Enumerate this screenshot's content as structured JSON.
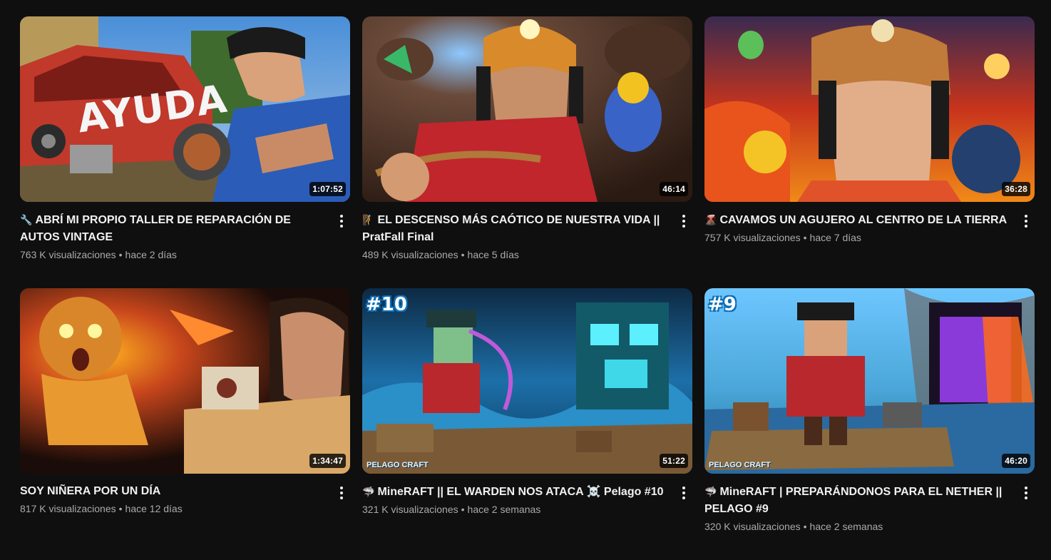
{
  "colors": {
    "background": "#0f0f0f",
    "text_primary": "#f1f1f1",
    "text_secondary": "#aaaaaa"
  },
  "videos": [
    {
      "emoji": "🔧",
      "title": "ABRÍ MI PROPIO TALLER DE REPARACIÓN DE AUTOS VINTAGE",
      "views": "763 K visualizaciones",
      "age": "hace 2 días",
      "duration": "1:07:52",
      "thumb_text": "AYUDA"
    },
    {
      "emoji": "🧗",
      "title": "EL DESCENSO MÁS CAÓTICO DE NUESTRA VIDA || PratFall Final",
      "views": "489 K visualizaciones",
      "age": "hace 5 días",
      "duration": "46:14"
    },
    {
      "emoji": "🌋",
      "title": "CAVAMOS UN AGUJERO AL CENTRO DE LA TIERRA",
      "views": "757 K visualizaciones",
      "age": "hace 7 días",
      "duration": "36:28"
    },
    {
      "emoji": "",
      "title": "SOY NIÑERA POR UN DÍA",
      "views": "817 K visualizaciones",
      "age": "hace 12 días",
      "duration": "1:34:47"
    },
    {
      "emoji": "🦈",
      "title": "MineRAFT || EL WARDEN NOS ATACA ☠️ Pelago #10",
      "views": "321 K visualizaciones",
      "age": "hace 2 semanas",
      "duration": "51:22",
      "thumb_badge": "#10",
      "thumb_logo": "PELAGO CRAFT"
    },
    {
      "emoji": "🦈",
      "title": "MineRAFT | PREPARÁNDONOS PARA EL NETHER || PELAGO #9",
      "views": "320 K visualizaciones",
      "age": "hace 2 semanas",
      "duration": "46:20",
      "thumb_badge": "#9",
      "thumb_logo": "PELAGO CRAFT"
    }
  ]
}
